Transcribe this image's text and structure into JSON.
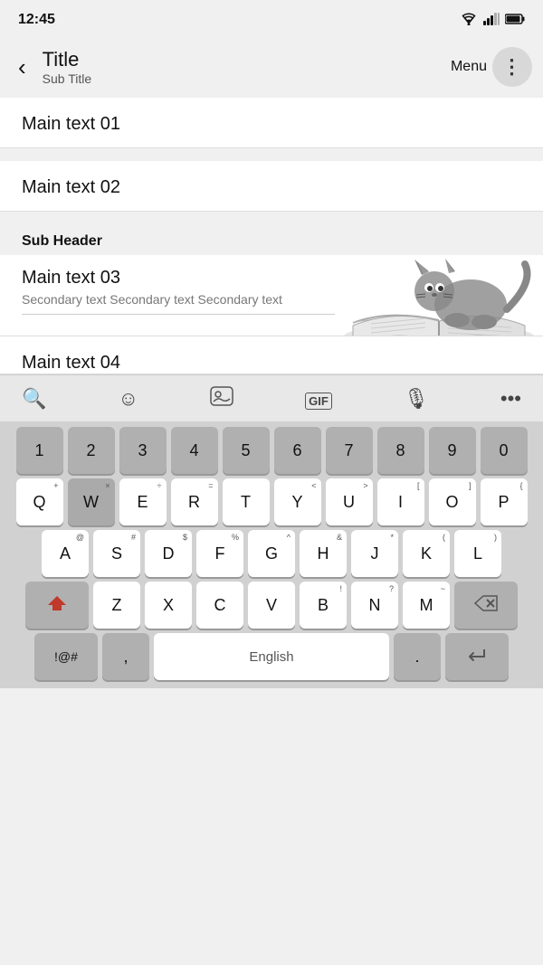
{
  "statusBar": {
    "time": "12:45",
    "wifiIcon": "wifi",
    "signalIcon": "signal",
    "batteryIcon": "battery"
  },
  "appBar": {
    "backLabel": "‹",
    "title": "Title",
    "subtitle": "Sub Title",
    "menuLabel": "Menu",
    "moreIcon": "⋮"
  },
  "content": {
    "item1": "Main text 01",
    "item2": "Main text 02",
    "subHeader": "Sub Header",
    "item3Main": "Main text 03",
    "item3Secondary": "Secondary text Secondary text Secondary text",
    "item4": "Main text 04"
  },
  "keyboard": {
    "toolbar": {
      "searchIcon": "🔍",
      "emojiIcon": "☺",
      "stickerIcon": "🎭",
      "gifLabel": "GIF",
      "micIcon": "🎙",
      "moreIcon": "•••"
    },
    "row1": [
      "1",
      "2",
      "3",
      "4",
      "5",
      "6",
      "7",
      "8",
      "9",
      "0"
    ],
    "row2": [
      "Q",
      "W",
      "E",
      "R",
      "T",
      "Y",
      "U",
      "I",
      "O",
      "P"
    ],
    "row2secondary": [
      "+",
      "×",
      "÷",
      "=",
      "",
      "<",
      ">",
      "[",
      "]",
      "{"
    ],
    "row3": [
      "A",
      "S",
      "D",
      "F",
      "G",
      "H",
      "J",
      "K",
      "L"
    ],
    "row3secondary": [
      "@",
      "#",
      "$",
      "%",
      "^",
      "&",
      "*",
      "(",
      ")",
      "-"
    ],
    "row4": [
      "Z",
      "X",
      "C",
      "V",
      "B",
      "N",
      "M"
    ],
    "row4secondary": [
      "",
      "",
      "",
      "",
      "!",
      "?",
      "~"
    ],
    "symbolsLabel": "!@#",
    "commaLabel": ",",
    "spacebar": "English",
    "periodLabel": ".",
    "enterIcon": "↵"
  }
}
